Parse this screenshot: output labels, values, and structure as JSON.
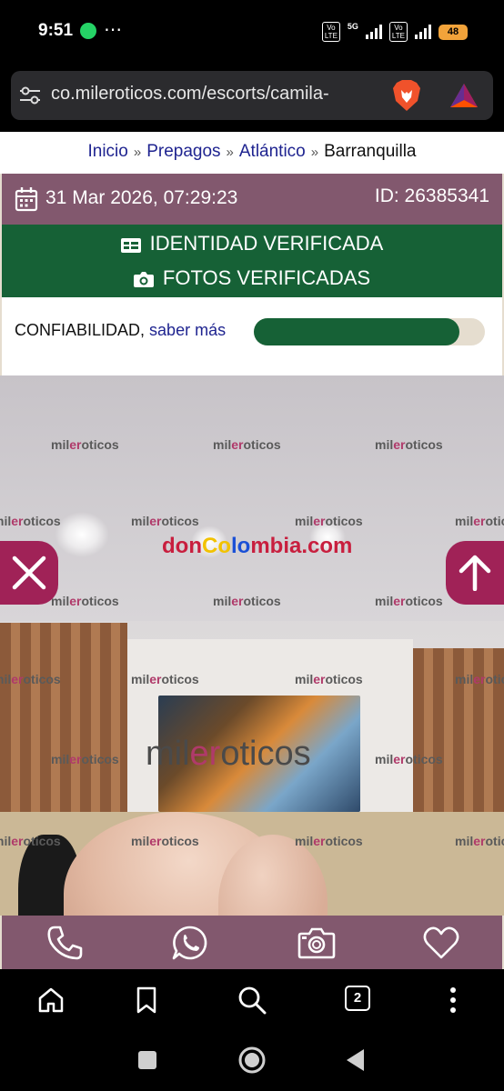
{
  "status": {
    "time": "9:51",
    "more": "⋯",
    "network": "5G",
    "volte": "Vo\nLTE",
    "battery": "48"
  },
  "browser": {
    "url": "co.mileroticos.com/escorts/camila-",
    "tabs_count": "2"
  },
  "breadcrumb": {
    "items": [
      "Inicio",
      "Prepagos",
      "Atlántico"
    ],
    "separator": "»",
    "current": "Barranquilla"
  },
  "listing": {
    "date": "31 Mar 2026, 07:29:23",
    "id": "ID: 26385341",
    "identity": "IDENTIDAD VERIFICADA",
    "photos": "FOTOS VERIFICADAS",
    "trust_label": "CONFIABILIDAD,",
    "trust_link": "saber más",
    "trust_level": 0.89
  },
  "photo": {
    "watermark_prefix": "mil",
    "watermark_accent": "er",
    "watermark_suffix": "o",
    "watermark_end": "ticos",
    "site_parts": [
      "don",
      "Co",
      "lo",
      "mbia",
      ".com"
    ]
  },
  "colors": {
    "mauve": "#82586e",
    "green": "#166136",
    "magenta": "#a02257",
    "link": "#1f2490"
  },
  "icons": [
    "tune-icon",
    "brave-lion-icon",
    "bat-triangle-icon",
    "calendar-icon",
    "id-card-icon",
    "camera-icon",
    "close-icon",
    "arrow-up-icon",
    "phone-icon",
    "whatsapp-icon",
    "camera-outline-icon",
    "heart-icon",
    "home-icon",
    "bookmark-icon",
    "search-icon",
    "more-vert-icon",
    "square-icon",
    "circle-icon",
    "back-triangle-icon"
  ]
}
